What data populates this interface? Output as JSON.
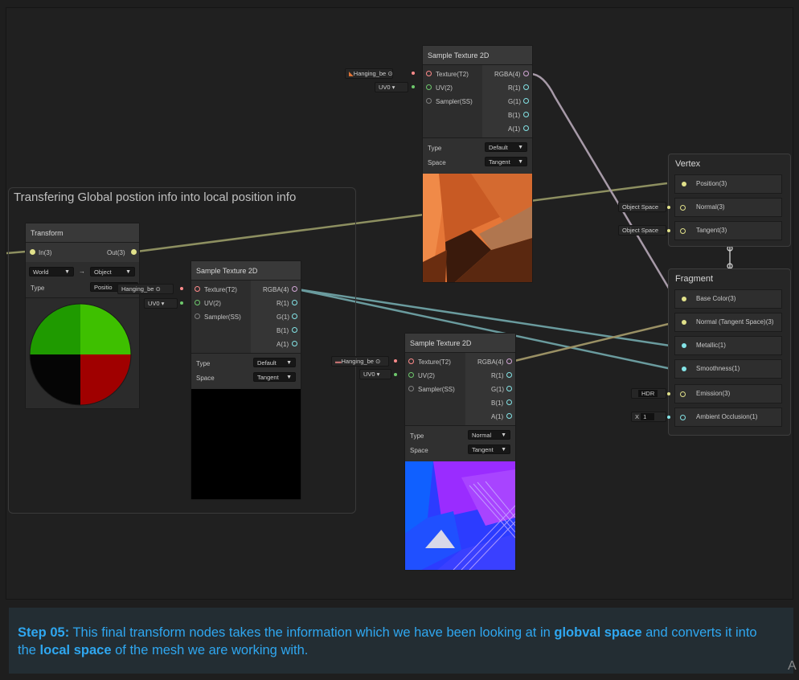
{
  "group": {
    "title": "Transfering Global postion info into local position info"
  },
  "transform_node": {
    "title": "Transform",
    "in_port": "In(3)",
    "out_port": "Out(3)",
    "from_space": "World",
    "arrow": "→",
    "to_space": "Object",
    "type_label": "Type",
    "type_value": "Positio"
  },
  "sample_nodes": [
    {
      "title": "Sample Texture 2D",
      "texture_input": "Hanging_be",
      "uv_input": "UV0",
      "inputs": [
        "Texture(T2)",
        "UV(2)",
        "Sampler(SS)"
      ],
      "outputs": [
        "RGBA(4)",
        "R(1)",
        "G(1)",
        "B(1)",
        "A(1)"
      ],
      "type_label": "Type",
      "type_value": "Default",
      "space_label": "Space",
      "space_value": "Tangent"
    },
    {
      "title": "Sample Texture 2D",
      "texture_input": "Hanging_be",
      "uv_input": "UV0",
      "inputs": [
        "Texture(T2)",
        "UV(2)",
        "Sampler(SS)"
      ],
      "outputs": [
        "RGBA(4)",
        "R(1)",
        "G(1)",
        "B(1)",
        "A(1)"
      ],
      "type_label": "Type",
      "type_value": "Default",
      "space_label": "Space",
      "space_value": "Tangent"
    },
    {
      "title": "Sample Texture 2D",
      "texture_input": "Hanging_be",
      "uv_input": "UV0",
      "inputs": [
        "Texture(T2)",
        "UV(2)",
        "Sampler(SS)"
      ],
      "outputs": [
        "RGBA(4)",
        "R(1)",
        "G(1)",
        "B(1)",
        "A(1)"
      ],
      "type_label": "Type",
      "type_value": "Normal",
      "space_label": "Space",
      "space_value": "Tangent"
    }
  ],
  "vertex": {
    "title": "Vertex",
    "slots": [
      "Position(3)",
      "Normal(3)",
      "Tangent(3)"
    ],
    "normal_input": "Object Space",
    "tangent_input": "Object Space"
  },
  "fragment": {
    "title": "Fragment",
    "slots": [
      "Base Color(3)",
      "Normal (Tangent Space)(3)",
      "Metallic(1)",
      "Smoothness(1)",
      "Emission(3)",
      "Ambient Occlusion(1)"
    ],
    "emission_input": "HDR",
    "ao_axis": "X",
    "ao_value": "1"
  },
  "caption": {
    "step": "Step 05:",
    "t1": " This final transform nodes takes the information which we have been looking at in ",
    "b1": "globval space",
    "t2": " and converts it into the ",
    "b2": "local space",
    "t3": " of the mesh we are working with."
  },
  "corner_letter": "A",
  "colors": {
    "vector3": "#e1e18a",
    "vector4": "#d2a6d6",
    "vector2": "#6ec86c",
    "vector1": "#84e4e7",
    "texture": "#ff8b8b",
    "caption_text": "#2fa7f0"
  }
}
